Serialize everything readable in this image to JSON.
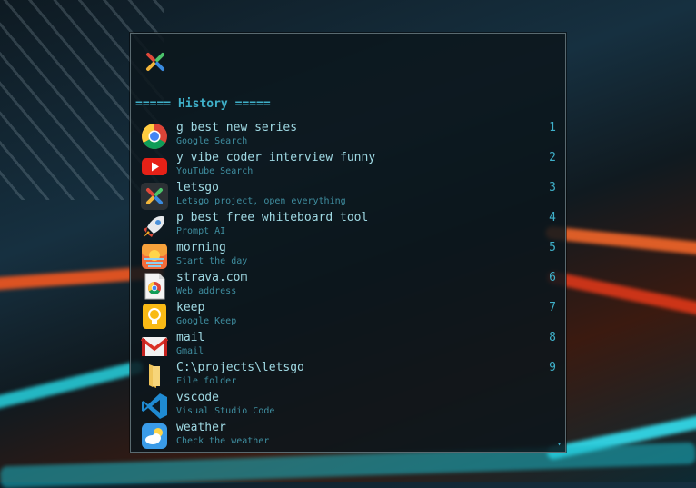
{
  "launcher": {
    "history_header": "===== History =====",
    "scroll_indicator": "▾",
    "colors": {
      "accent": "#3fb0c9",
      "title_text": "#9fd9e3",
      "subtitle_text": "#3f8ea0"
    },
    "items": [
      {
        "title": "g best new series",
        "subtitle": "Google Search",
        "number": "1",
        "icon": "chrome-icon"
      },
      {
        "title": "y vibe coder interview funny",
        "subtitle": "YouTube Search",
        "number": "2",
        "icon": "youtube-icon"
      },
      {
        "title": "letsgo",
        "subtitle": "Letsgo project, open everything",
        "number": "3",
        "icon": "letsgo-icon"
      },
      {
        "title": "p best free whiteboard tool",
        "subtitle": "Prompt AI",
        "number": "4",
        "icon": "rocket-icon"
      },
      {
        "title": "morning",
        "subtitle": "Start the day",
        "number": "5",
        "icon": "sunrise-icon"
      },
      {
        "title": "strava.com",
        "subtitle": "Web address",
        "number": "6",
        "icon": "web-page-icon"
      },
      {
        "title": "keep",
        "subtitle": "Google Keep",
        "number": "7",
        "icon": "keep-bulb-icon"
      },
      {
        "title": "mail",
        "subtitle": "Gmail",
        "number": "8",
        "icon": "gmail-icon"
      },
      {
        "title": "C:\\projects\\letsgo",
        "subtitle": "File folder",
        "number": "9",
        "icon": "folder-icon"
      },
      {
        "title": "vscode",
        "subtitle": "Visual Studio Code",
        "number": "",
        "icon": "vscode-icon"
      },
      {
        "title": "weather",
        "subtitle": "Check the weather",
        "number": "",
        "icon": "weather-icon"
      }
    ]
  }
}
